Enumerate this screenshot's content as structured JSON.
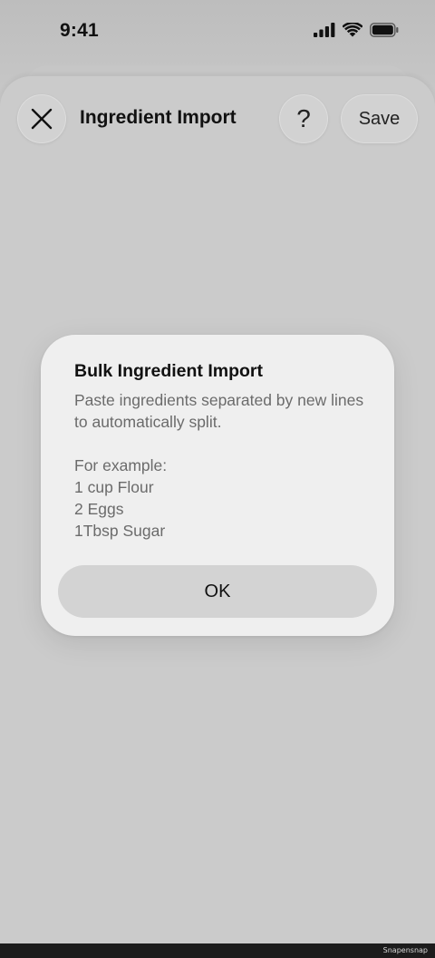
{
  "status_bar": {
    "time": "9:41"
  },
  "nav": {
    "title": "Ingredient Import",
    "help_label": "?",
    "save_label": "Save"
  },
  "dialog": {
    "title": "Bulk Ingredient Import",
    "description": "Paste ingredients separated by new lines to automatically split.",
    "example_heading": "For example:",
    "examples": [
      "1 cup Flour",
      "2 Eggs",
      "1Tbsp Sugar"
    ],
    "ok_label": "OK"
  },
  "footer": {
    "watermark": "Snapensnap"
  },
  "icons": {
    "close": "close-icon",
    "signal": "cellular-signal-icon",
    "wifi": "wifi-icon",
    "battery": "battery-icon"
  },
  "colors": {
    "background": "#cdcdcd",
    "dialog": "#efefef",
    "button": "#d3d3d3"
  }
}
